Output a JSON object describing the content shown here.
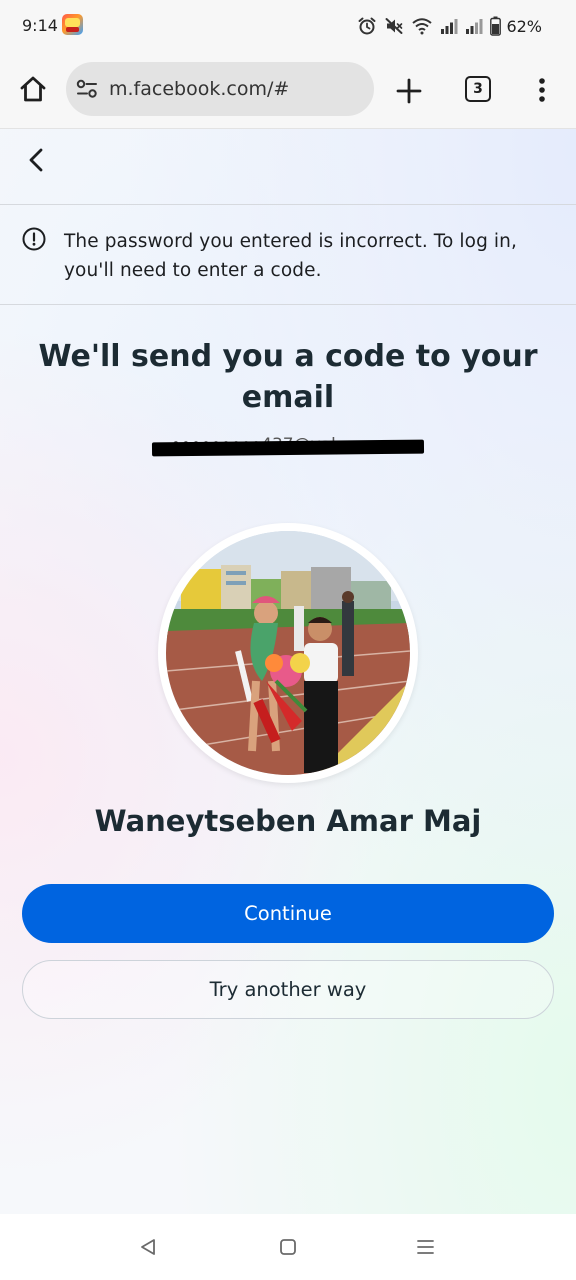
{
  "status_bar": {
    "time": "9:14",
    "app_icon": "game-app-icon",
    "icons": [
      "alarm-icon",
      "mute-icon",
      "wifi-icon",
      "signal-icon",
      "signal-icon",
      "battery-icon"
    ],
    "battery_percent": "62%"
  },
  "browser": {
    "home_icon": "home-icon",
    "url_settings_icon": "tune-icon",
    "url": "m.facebook.com/#",
    "new_tab_icon": "plus-icon",
    "tab_count": "3",
    "menu_icon": "more-vertical-icon"
  },
  "page": {
    "back_icon": "chevron-left-icon",
    "notice_icon": "info-circle-icon",
    "notice": "The password you entered is incorrect. To log in, you'll need to enter a code.",
    "headline": "We'll send you a code to your email",
    "email_partial": "•••••••••437@yahoo.com",
    "profile_name": "Waneytseben Amar Maj",
    "continue_label": "Continue",
    "try_another_label": "Try another way"
  },
  "colors": {
    "primary_button": "#0064e0",
    "headline": "#1c2b33",
    "page_background": "#f6f8fb"
  },
  "nav_bar": {
    "icons": [
      "back-triangle-icon",
      "home-square-icon",
      "recents-lines-icon"
    ]
  }
}
